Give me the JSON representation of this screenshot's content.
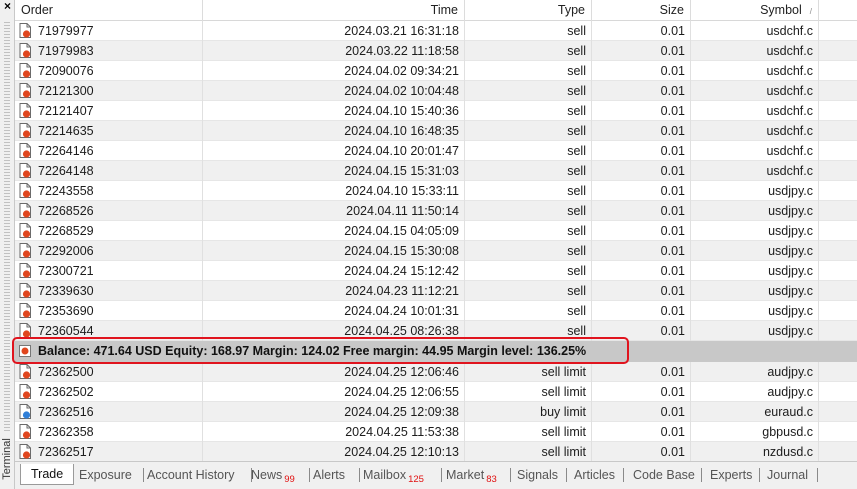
{
  "window": {
    "close_glyph": "×",
    "side_label": "Terminal"
  },
  "columns": {
    "order": "Order",
    "time": "Time",
    "type": "Type",
    "size": "Size",
    "symbol": "Symbol",
    "symbol_sort": "/"
  },
  "rows_top": [
    {
      "order": "71979977",
      "time": "2024.03.21 16:31:18",
      "type": "sell",
      "size": "0.01",
      "symbol": "usdchf.c"
    },
    {
      "order": "71979983",
      "time": "2024.03.22 11:18:58",
      "type": "sell",
      "size": "0.01",
      "symbol": "usdchf.c"
    },
    {
      "order": "72090076",
      "time": "2024.04.02 09:34:21",
      "type": "sell",
      "size": "0.01",
      "symbol": "usdchf.c"
    },
    {
      "order": "72121300",
      "time": "2024.04.02 10:04:48",
      "type": "sell",
      "size": "0.01",
      "symbol": "usdchf.c"
    },
    {
      "order": "72121407",
      "time": "2024.04.10 15:40:36",
      "type": "sell",
      "size": "0.01",
      "symbol": "usdchf.c"
    },
    {
      "order": "72214635",
      "time": "2024.04.10 16:48:35",
      "type": "sell",
      "size": "0.01",
      "symbol": "usdchf.c"
    },
    {
      "order": "72264146",
      "time": "2024.04.10 20:01:47",
      "type": "sell",
      "size": "0.01",
      "symbol": "usdchf.c"
    },
    {
      "order": "72264148",
      "time": "2024.04.15 15:31:03",
      "type": "sell",
      "size": "0.01",
      "symbol": "usdchf.c"
    },
    {
      "order": "72243558",
      "time": "2024.04.10 15:33:11",
      "type": "sell",
      "size": "0.01",
      "symbol": "usdjpy.c"
    },
    {
      "order": "72268526",
      "time": "2024.04.11 11:50:14",
      "type": "sell",
      "size": "0.01",
      "symbol": "usdjpy.c"
    },
    {
      "order": "72268529",
      "time": "2024.04.15 04:05:09",
      "type": "sell",
      "size": "0.01",
      "symbol": "usdjpy.c"
    },
    {
      "order": "72292006",
      "time": "2024.04.15 15:30:08",
      "type": "sell",
      "size": "0.01",
      "symbol": "usdjpy.c"
    },
    {
      "order": "72300721",
      "time": "2024.04.24 15:12:42",
      "type": "sell",
      "size": "0.01",
      "symbol": "usdjpy.c"
    },
    {
      "order": "72339630",
      "time": "2024.04.23 11:12:21",
      "type": "sell",
      "size": "0.01",
      "symbol": "usdjpy.c"
    },
    {
      "order": "72353690",
      "time": "2024.04.24 10:01:31",
      "type": "sell",
      "size": "0.01",
      "symbol": "usdjpy.c"
    },
    {
      "order": "72360544",
      "time": "2024.04.25 08:26:38",
      "type": "sell",
      "size": "0.01",
      "symbol": "usdjpy.c"
    }
  ],
  "balance_line": "Balance: 471.64 USD  Equity: 168.97  Margin: 124.02  Free margin: 44.95  Margin level: 136.25%",
  "rows_bottom": [
    {
      "order": "72362500",
      "time": "2024.04.25 12:06:46",
      "type": "sell limit",
      "size": "0.01",
      "symbol": "audjpy.c",
      "badge": "red"
    },
    {
      "order": "72362502",
      "time": "2024.04.25 12:06:55",
      "type": "sell limit",
      "size": "0.01",
      "symbol": "audjpy.c",
      "badge": "red"
    },
    {
      "order": "72362516",
      "time": "2024.04.25 12:09:38",
      "type": "buy limit",
      "size": "0.01",
      "symbol": "euraud.c",
      "badge": "blue"
    },
    {
      "order": "72362358",
      "time": "2024.04.25 11:53:38",
      "type": "sell limit",
      "size": "0.01",
      "symbol": "gbpusd.c",
      "badge": "red"
    },
    {
      "order": "72362517",
      "time": "2024.04.25 12:10:13",
      "type": "sell limit",
      "size": "0.01",
      "symbol": "nzdusd.c",
      "badge": "red"
    }
  ],
  "tabs": [
    {
      "label": "Trade",
      "count": "",
      "active": true
    },
    {
      "label": "Exposure",
      "count": ""
    },
    {
      "label": "Account History",
      "count": ""
    },
    {
      "label": "News",
      "count": "99"
    },
    {
      "label": "Alerts",
      "count": ""
    },
    {
      "label": "Mailbox",
      "count": "125"
    },
    {
      "label": "Market",
      "count": "83"
    },
    {
      "label": "Signals",
      "count": ""
    },
    {
      "label": "Articles",
      "count": ""
    },
    {
      "label": "Code Base",
      "count": ""
    },
    {
      "label": "Experts",
      "count": ""
    },
    {
      "label": "Journal",
      "count": ""
    }
  ],
  "colors": {
    "sell_badge": "#e0461e",
    "buy_badge": "#2f7fd8",
    "highlight": "#e0141e",
    "balance_bg": "#c8c8c8"
  }
}
